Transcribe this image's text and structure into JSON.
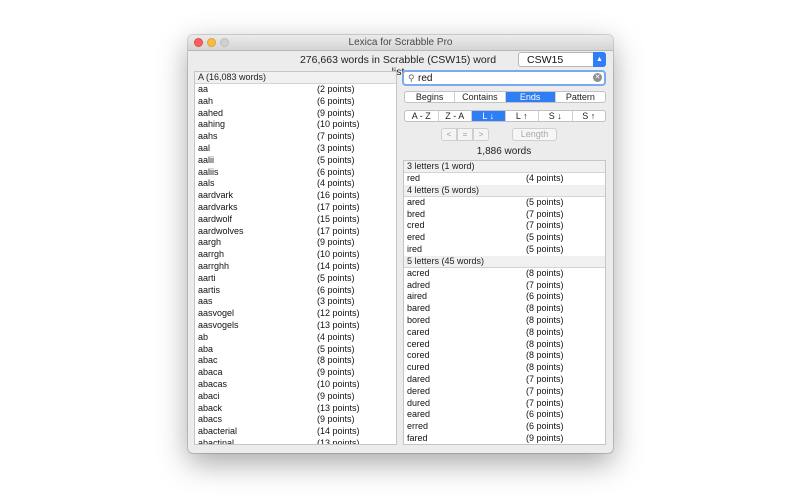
{
  "window": {
    "title": "Lexica for Scrabble Pro"
  },
  "header": {
    "count_text": "276,663 words in Scrabble (CSW15) word list",
    "dictionary": "CSW15"
  },
  "left_list": {
    "section": "A (16,083 words)",
    "words": [
      {
        "w": "aa",
        "p": "(2 points)"
      },
      {
        "w": "aah",
        "p": "(6 points)"
      },
      {
        "w": "aahed",
        "p": "(9 points)"
      },
      {
        "w": "aahing",
        "p": "(10 points)"
      },
      {
        "w": "aahs",
        "p": "(7 points)"
      },
      {
        "w": "aal",
        "p": "(3 points)"
      },
      {
        "w": "aalii",
        "p": "(5 points)"
      },
      {
        "w": "aaliis",
        "p": "(6 points)"
      },
      {
        "w": "aals",
        "p": "(4 points)"
      },
      {
        "w": "aardvark",
        "p": "(16 points)"
      },
      {
        "w": "aardvarks",
        "p": "(17 points)"
      },
      {
        "w": "aardwolf",
        "p": "(15 points)"
      },
      {
        "w": "aardwolves",
        "p": "(17 points)"
      },
      {
        "w": "aargh",
        "p": "(9 points)"
      },
      {
        "w": "aarrgh",
        "p": "(10 points)"
      },
      {
        "w": "aarrghh",
        "p": "(14 points)"
      },
      {
        "w": "aarti",
        "p": "(5 points)"
      },
      {
        "w": "aartis",
        "p": "(6 points)"
      },
      {
        "w": "aas",
        "p": "(3 points)"
      },
      {
        "w": "aasvogel",
        "p": "(12 points)"
      },
      {
        "w": "aasvogels",
        "p": "(13 points)"
      },
      {
        "w": "ab",
        "p": "(4 points)"
      },
      {
        "w": "aba",
        "p": "(5 points)"
      },
      {
        "w": "abac",
        "p": "(8 points)"
      },
      {
        "w": "abaca",
        "p": "(9 points)"
      },
      {
        "w": "abacas",
        "p": "(10 points)"
      },
      {
        "w": "abaci",
        "p": "(9 points)"
      },
      {
        "w": "aback",
        "p": "(13 points)"
      },
      {
        "w": "abacs",
        "p": "(9 points)"
      },
      {
        "w": "abacterial",
        "p": "(14 points)"
      },
      {
        "w": "abactinal",
        "p": "(13 points)"
      }
    ]
  },
  "search": {
    "value": "red"
  },
  "match_modes": {
    "items": [
      "Begins",
      "Contains",
      "Ends",
      "Pattern"
    ],
    "selected": "Ends"
  },
  "sort_modes": {
    "items": [
      "A - Z",
      "Z - A",
      "L ↓",
      "L ↑",
      "S ↓",
      "S ↑"
    ],
    "selected": "L ↓"
  },
  "length_controls": {
    "minus": "<",
    "equals": "=",
    "plus": ">",
    "length_label": "Length"
  },
  "results": {
    "count_text": "1,886 words",
    "groups": [
      {
        "header": "3 letters (1 word)",
        "words": [
          {
            "w": "red",
            "p": "(4 points)"
          }
        ]
      },
      {
        "header": "4 letters (5 words)",
        "words": [
          {
            "w": "ared",
            "p": "(5 points)"
          },
          {
            "w": "bred",
            "p": "(7 points)"
          },
          {
            "w": "cred",
            "p": "(7 points)"
          },
          {
            "w": "ered",
            "p": "(5 points)"
          },
          {
            "w": "ired",
            "p": "(5 points)"
          }
        ]
      },
      {
        "header": "5 letters (45 words)",
        "words": [
          {
            "w": "acred",
            "p": "(8 points)"
          },
          {
            "w": "adred",
            "p": "(7 points)"
          },
          {
            "w": "aired",
            "p": "(6 points)"
          },
          {
            "w": "bared",
            "p": "(8 points)"
          },
          {
            "w": "bored",
            "p": "(8 points)"
          },
          {
            "w": "cared",
            "p": "(8 points)"
          },
          {
            "w": "cered",
            "p": "(8 points)"
          },
          {
            "w": "cored",
            "p": "(8 points)"
          },
          {
            "w": "cured",
            "p": "(8 points)"
          },
          {
            "w": "dared",
            "p": "(7 points)"
          },
          {
            "w": "dered",
            "p": "(7 points)"
          },
          {
            "w": "dured",
            "p": "(7 points)"
          },
          {
            "w": "eared",
            "p": "(6 points)"
          },
          {
            "w": "erred",
            "p": "(6 points)"
          },
          {
            "w": "fared",
            "p": "(9 points)"
          }
        ]
      }
    ]
  },
  "colors": {
    "accent": "#2f7ef5",
    "search_focus": "#7aaaf0"
  }
}
